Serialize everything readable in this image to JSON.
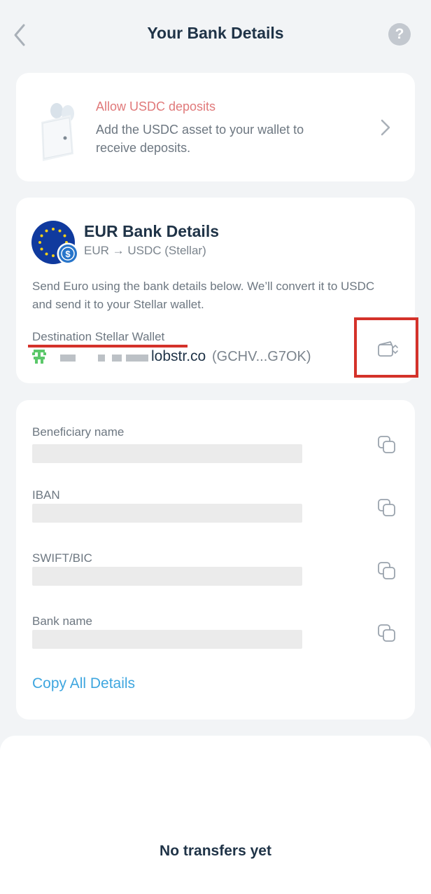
{
  "header": {
    "title": "Your Bank Details",
    "back_icon": "chevron-left-icon",
    "help_label": "?"
  },
  "usdc_prompt": {
    "title": "Allow USDC deposits",
    "text": "Add the USDC asset to your wallet to receive deposits.",
    "title_color": "#e0797a"
  },
  "eur_details": {
    "title": "EUR Bank Details",
    "subtitle": "EUR → USDC (Stellar)",
    "description": "Send Euro using the bank details below. We’ll convert it to USDC and send it to your Stellar wallet.",
    "destination_label": "Destination Stellar Wallet",
    "wallet_domain": "lobstr.co",
    "wallet_key": "(GCHV...G7OK)"
  },
  "bank_fields": [
    {
      "label": "Beneficiary name"
    },
    {
      "label": "IBAN"
    },
    {
      "label": "SWIFT/BIC"
    },
    {
      "label": "Bank name"
    }
  ],
  "copy_all_label": "Copy All Details",
  "transfers": {
    "empty_text": "No transfers yet"
  },
  "colors": {
    "accent": "#3ea6df",
    "highlight": "#d4322a",
    "text_primary": "#1f3347"
  }
}
